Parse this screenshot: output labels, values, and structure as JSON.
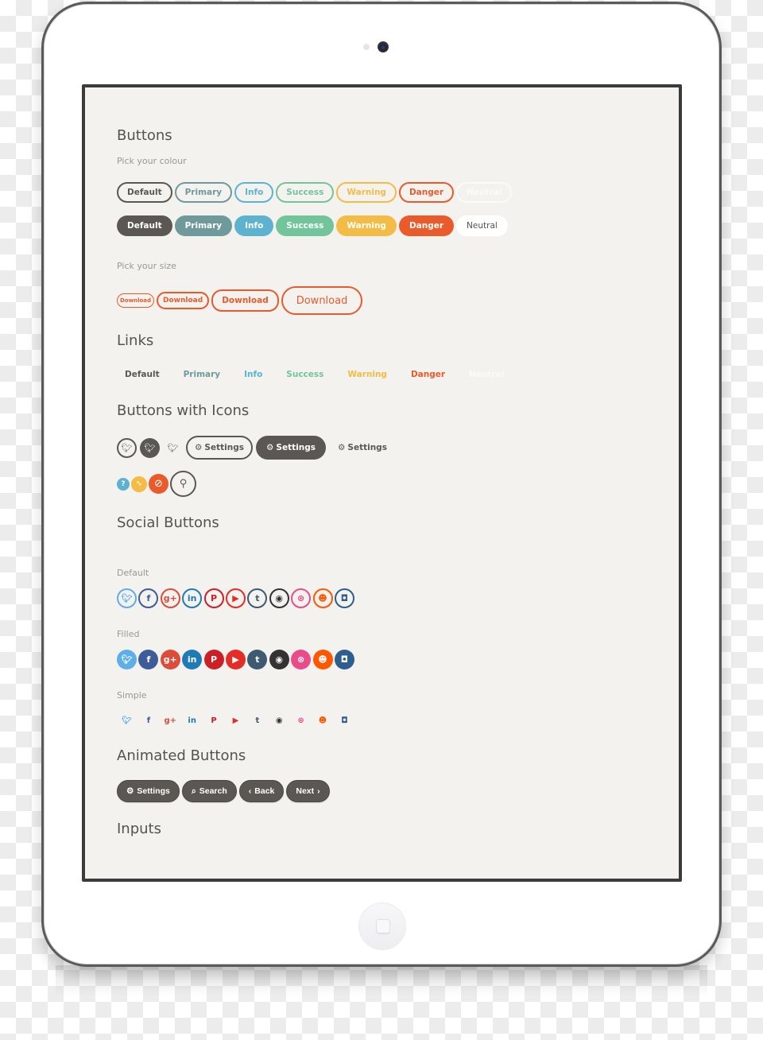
{
  "colors": {
    "default": "#5b5753",
    "primary": "#6f9a9c",
    "info": "#5bb3d0",
    "success": "#72c49a",
    "warning": "#f4bc44",
    "danger": "#ea5a2a",
    "neutral_outline": "#f7f6f3",
    "neutral_text": "#555350",
    "screen_bg": "#f3f2ef"
  },
  "sections": {
    "buttons": {
      "title": "Buttons",
      "pick_colour": "Pick your colour",
      "outline_buttons": [
        "Default",
        "Primary",
        "Info",
        "Success",
        "Warning",
        "Danger",
        "Neutral"
      ],
      "solid_buttons": [
        "Default",
        "Primary",
        "Info",
        "Success",
        "Warning",
        "Danger",
        "Neutral"
      ],
      "pick_size": "Pick your size",
      "size_buttons": [
        "Download",
        "Download",
        "Download",
        "Download"
      ]
    },
    "links": {
      "title": "Links",
      "items": [
        "Default",
        "Primary",
        "Info",
        "Success",
        "Warning",
        "Danger",
        "Neutral"
      ]
    },
    "icon_buttons": {
      "title": "Buttons with Icons",
      "settings_outline": "Settings",
      "settings_solid": "Settings",
      "settings_plain": "Settings",
      "icons": {
        "twitter": "twitter-icon",
        "gear": "gear-icon",
        "question": "question-icon",
        "pulse": "pulse-icon",
        "ban": "ban-icon",
        "chat": "chat-icon"
      }
    },
    "social": {
      "title": "Social Buttons",
      "default_label": "Default",
      "filled_label": "Filled",
      "simple_label": "Simple",
      "networks": [
        {
          "name": "twitter",
          "glyph": "🐦",
          "color": "#5eaee8"
        },
        {
          "name": "facebook",
          "glyph": "f",
          "color": "#3e5c9a"
        },
        {
          "name": "google-plus",
          "glyph": "g+",
          "color": "#dd4b39"
        },
        {
          "name": "linkedin",
          "glyph": "in",
          "color": "#1f7bb6"
        },
        {
          "name": "pinterest",
          "glyph": "P",
          "color": "#cb2027"
        },
        {
          "name": "youtube",
          "glyph": "▶",
          "color": "#e52d27"
        },
        {
          "name": "tumblr",
          "glyph": "t",
          "color": "#3d5a70"
        },
        {
          "name": "github",
          "glyph": "◉",
          "color": "#333333"
        },
        {
          "name": "dribbble",
          "glyph": "⊛",
          "color": "#ea4c89"
        },
        {
          "name": "reddit",
          "glyph": "☻",
          "color": "#ff5700"
        },
        {
          "name": "instagram",
          "glyph": "◘",
          "color": "#2e5e8e"
        }
      ]
    },
    "animated": {
      "title": "Animated Buttons",
      "buttons": [
        {
          "label": "Settings",
          "icon": "⚙"
        },
        {
          "label": "Search",
          "icon": "⌕"
        },
        {
          "label": "Back",
          "icon": "‹"
        },
        {
          "label": "Next",
          "icon": "›"
        }
      ]
    },
    "inputs": {
      "title": "Inputs"
    }
  }
}
